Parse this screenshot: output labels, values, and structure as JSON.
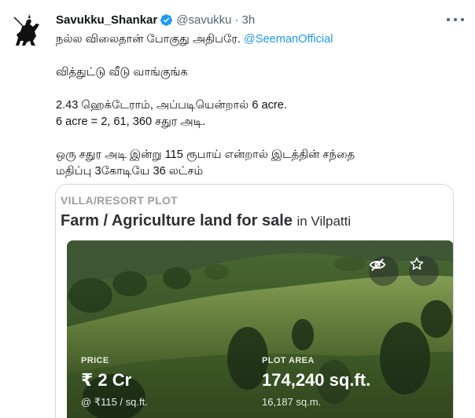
{
  "tweet": {
    "author": {
      "display_name": "Savukku_Shankar",
      "handle": "@savukku",
      "verified": true
    },
    "separator": "·",
    "time": "3h",
    "lines": {
      "line1_text": "நல்ல விலைதான் போகுது அதிபரே. ",
      "line1_mention": "@SeemanOfficial",
      "line2": "வித்துட்டு வீடு வாங்குங்க",
      "line3": "2.43 ஹெக்டேராம், அப்படியென்றால்  6 acre.",
      "line4": "6 acre =  2, 61, 360 சதுர அடி.",
      "line5": "ஒரு சதுர அடி இன்று 115 ரூபாய் என்றால் இடத்தின் சந்தை",
      "line6": "மதிப்பு 3கோடியே 36 லட்சம்"
    },
    "icons": {
      "avatar": "silhouette-rider-avatar",
      "verified": "verified-badge-icon",
      "more": "more-options-icon",
      "hide": "eye-off-icon",
      "favorite": "star-icon"
    },
    "colors": {
      "mention": "#1d9bf0",
      "verified": "#1d9bf0",
      "secondary_text": "#536471"
    }
  },
  "card": {
    "category": "VILLA/RESORT PLOT",
    "title_bold": "Farm / Agriculture land for sale",
    "title_location": "in Vilpatti",
    "price": {
      "label": "PRICE",
      "value": "₹ 2 Cr",
      "sub": "@ ₹115 / sq.ft."
    },
    "area": {
      "label": "PLOT AREA",
      "value": "174,240 sq.ft.",
      "sub": "16,187 sq.m."
    }
  }
}
